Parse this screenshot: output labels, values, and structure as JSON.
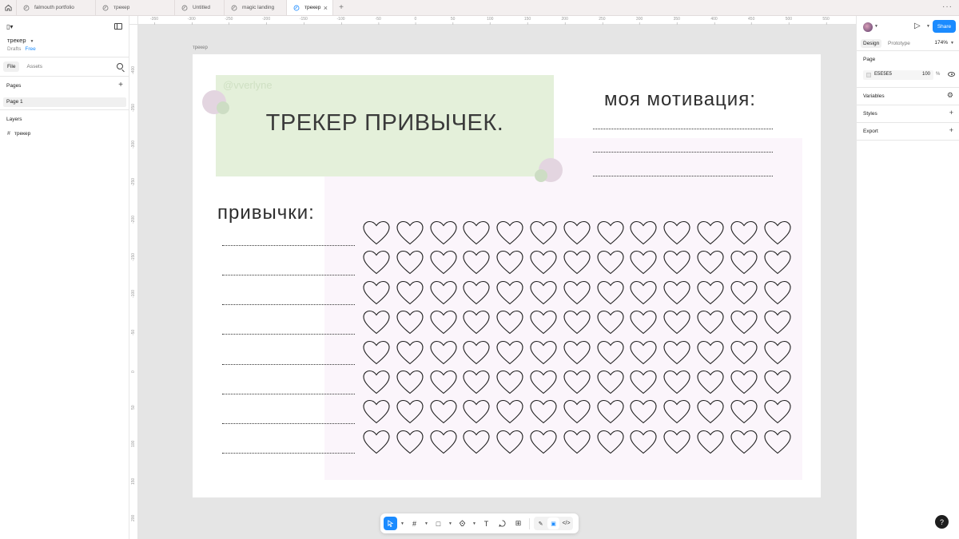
{
  "tabs": [
    {
      "label": "falmouth portfolio",
      "active": false
    },
    {
      "label": "трекер",
      "active": false
    },
    {
      "label": "Untitled",
      "active": false
    },
    {
      "label": "magic landing",
      "active": false
    },
    {
      "label": "трекер",
      "active": true
    }
  ],
  "left_panel": {
    "file_name": "трекер",
    "drafts": "Drafts",
    "plan": "Free",
    "tab_file": "File",
    "tab_assets": "Assets",
    "pages_title": "Pages",
    "pages": [
      "Page 1"
    ],
    "layers_title": "Layers",
    "layers": [
      "трекер"
    ]
  },
  "ruler": {
    "top": [
      "-350",
      "-300",
      "-250",
      "-200",
      "-150",
      "-100",
      "-50",
      "0",
      "50",
      "100",
      "150",
      "200",
      "250",
      "300",
      "350",
      "400",
      "450",
      "500",
      "550"
    ],
    "left": [
      "-400",
      "-350",
      "-300",
      "-250",
      "-200",
      "-150",
      "-100",
      "-50",
      "0",
      "50",
      "100",
      "150",
      "200"
    ]
  },
  "frame": {
    "label": "трекер",
    "handle": "@vverlyne",
    "title": "ТРЕКЕР ПРИВЫЧЕК.",
    "motivation_title": "моя мотивация:",
    "habits_title": "привычки:",
    "heart_rows": 8,
    "heart_cols": 13
  },
  "toolbar": {
    "tools": [
      "move-icon",
      "frame-icon",
      "rectangle-icon",
      "pen-icon",
      "text-icon",
      "comment-icon",
      "actions-icon"
    ]
  },
  "right_panel": {
    "share_label": "Share",
    "tab_design": "Design",
    "tab_prototype": "Prototype",
    "zoom": "174%",
    "page_label": "Page",
    "page_color": "E5E5E5",
    "page_opacity": "100",
    "percent_sign": "%",
    "variables": "Variables",
    "styles": "Styles",
    "export": "Export"
  },
  "help": "?",
  "colors": {
    "accent": "#1b8bff",
    "green_block": "#e4f0da",
    "pink_block": "#fbf5fb",
    "canvas": "#e5e5e5"
  }
}
